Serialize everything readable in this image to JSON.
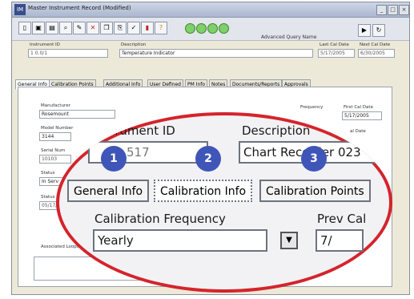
{
  "window": {
    "title": "Master Instrument Record (Modified)",
    "app_icon": "IM",
    "controls": [
      "_",
      "□",
      "×"
    ]
  },
  "toolbar": {
    "icons": [
      "new-icon",
      "save-icon",
      "open-icon",
      "find-icon",
      "edit-icon",
      "delete-icon",
      "copy-icon",
      "attach-icon",
      "check-icon",
      "print-icon",
      "help-icon",
      "first-icon",
      "prev-icon",
      "next-icon",
      "last-icon"
    ],
    "advanced_query_label": "Advanced Query Name",
    "advanced_query_value": ""
  },
  "header": {
    "instrument_id_label": "Instrument ID",
    "instrument_id_value": "1 0.0/1",
    "description_label": "Description",
    "description_value": "Temperature Indicator",
    "last_cal_label": "Last Cal Date",
    "last_cal_value": "5/17/2005",
    "next_cal_label": "Next Cal Date",
    "next_cal_value": "6/30/2005"
  },
  "tabs": [
    "General Info",
    "Calibration Points",
    "Additional Info",
    "User Defined",
    "PM Info",
    "Notes",
    "Documents/Reports",
    "Approvals"
  ],
  "form": {
    "manufacturer_label": "Manufacturer",
    "manufacturer_value": "Rosemount",
    "model_label": "Model Number",
    "model_value": "3144",
    "serial_label": "Serial Num",
    "serial_value": "10103",
    "status_label": "Status",
    "status_value": "In Serv",
    "status_m_label": "Status M",
    "status_m_value": "05/17/20",
    "frequency_label": "Frequency",
    "first_cal_label": "First Cal Date",
    "first_cal_value": "5/17/2005",
    "next_date_label": "al Date",
    "loops_label": "Associated Loops/System"
  },
  "zoom": {
    "instrument_id_label": "nstrument ID",
    "instrument_id_value": "517",
    "description_label": "Description",
    "description_value": "Chart Recorder 023",
    "tab1": "General Info",
    "tab2": "Calibration Info",
    "tab3": "Calibration Points",
    "cal_freq_label": "Calibration Frequency",
    "cal_freq_value": "Yearly",
    "prev_label": "Prev Cal",
    "prev_value": "7/",
    "badges": [
      "1",
      "2",
      "3"
    ]
  },
  "colors": {
    "ellipse": "#d4242c",
    "badge": "#3f55b8"
  }
}
